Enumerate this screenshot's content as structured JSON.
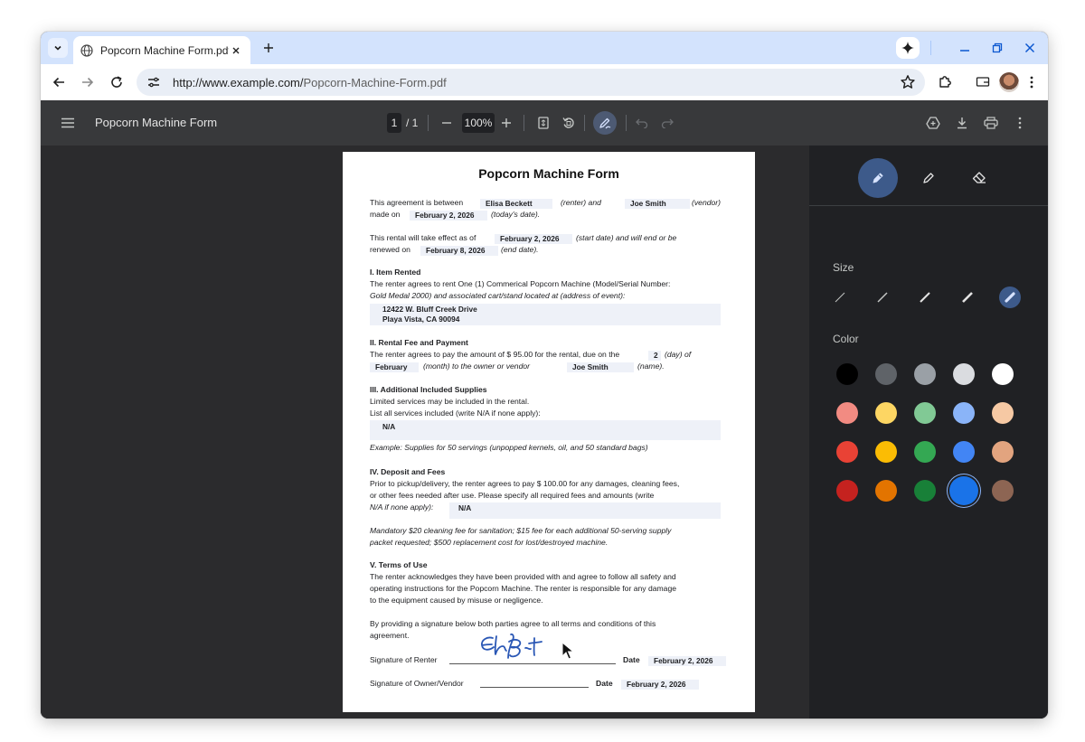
{
  "browser": {
    "tab_title": "Popcorn Machine Form.pdf",
    "url_domain": "http://www.example.com/",
    "url_path": "Popcorn-Machine-Form.pdf"
  },
  "pdf_toolbar": {
    "title": "Popcorn Machine Form",
    "current_page": "1",
    "total_pages": "/ 1",
    "zoom": "100%"
  },
  "document": {
    "title": "Popcorn Machine Form",
    "intro": {
      "line1": "This agreement is between",
      "renter_name": "Elisa Beckett",
      "renter_tag": "(renter) and",
      "vendor_name": "Joe Smith",
      "vendor_tag": "(vendor)",
      "line2": "made on",
      "made_date": "February 2, 2026",
      "made_tag": "(today's date)."
    },
    "effect": {
      "line1": "This rental will take effect as of",
      "start_date": "February 2, 2026",
      "start_tag": "(start date) and will end or be",
      "line2": "renewed on",
      "end_date": "February 8, 2026",
      "end_tag": "(end date)."
    },
    "s1": {
      "heading": "I. Item Rented",
      "line1": "The renter agrees to rent One (1) Commerical Popcorn Machine (Model/Serial Number:",
      "line2": "Gold Medal 2000) and associated cart/stand located at (address of event):",
      "addr1": "12422 W. Bluff Creek Drive",
      "addr2": "Playa Vista, CA 90094"
    },
    "s2": {
      "heading": "II. Rental Fee and Payment",
      "line1": "The renter agrees to pay the amount of $ 95.00 for the rental, due on the",
      "day": "2",
      "day_tag": "(day) of",
      "month": "February",
      "month_tag": "(month) to the owner or vendor",
      "name": "Joe Smith",
      "name_tag": "(name)."
    },
    "s3": {
      "heading": "III. Additional Included Supplies",
      "line1": "Limited services may be included in the rental.",
      "line2": "List all services included (write N/A if none apply):",
      "value": "N/A",
      "example": "Example: Supplies for 50 servings (unpopped kernels, oil, and 50 standard bags)"
    },
    "s4": {
      "heading": "IV. Deposit and Fees",
      "line1": "Prior to pickup/delivery, the renter agrees to pay $ 100.00 for any damages, cleaning fees,",
      "line2": "or other fees needed after use. Please specify all required fees and amounts (write",
      "line3": "N/A if none apply):",
      "value": "N/A",
      "note1": "Mandatory $20 cleaning fee for sanitation; $15 fee for each additional 50-serving supply",
      "note2": "packet requested; $500 replacement cost for lost/destroyed machine."
    },
    "s5": {
      "heading": "V. Terms of Use",
      "line1": "The renter acknowledges they have been provided with and agree to follow all safety and",
      "line2": "operating instructions for the Popcorn Machine. The renter is responsible for any damage",
      "line3": "to the equipment caused by misuse or negligence."
    },
    "closing": {
      "line1": "By providing a signature below both parties agree to all terms and conditions of this",
      "line2": "agreement."
    },
    "signatures": {
      "renter_label": "Signature of Renter",
      "owner_label": "Signature of Owner/Vendor",
      "date_label": "Date",
      "renter_date": "February 2, 2026",
      "owner_date": "February 2, 2026"
    }
  },
  "annotation_panel": {
    "size_label": "Size",
    "color_label": "Color",
    "selected_size_index": 4,
    "selected_color": "#1a73e8",
    "colors": [
      [
        "#000000",
        "#5f6368",
        "#9aa0a6",
        "#dadce0",
        "#ffffff"
      ],
      [
        "#f28b82",
        "#fdd663",
        "#81c995",
        "#8ab4f8",
        "#f6c9a4"
      ],
      [
        "#e94235",
        "#fbbc04",
        "#34a853",
        "#4285f4",
        "#e2a47f"
      ],
      [
        "#c5221f",
        "#e37400",
        "#188038",
        "#1a73e8",
        "#8d6553"
      ]
    ]
  },
  "theme": {
    "accent": "#3d5a8a",
    "tabstrip": "#d3e3fd"
  }
}
